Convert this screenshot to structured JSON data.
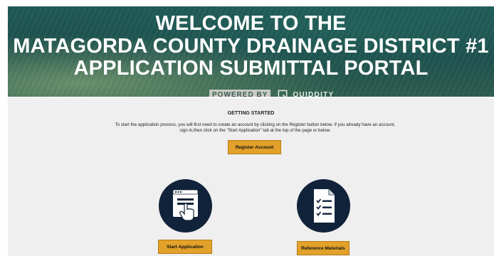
{
  "header": {
    "title_line1": "WELCOME TO THE",
    "title_line2": "MATAGORDA COUNTY DRAINAGE DISTRICT #1",
    "title_line3": "APPLICATION SUBMITTAL PORTAL",
    "powered_by": "POWERED BY",
    "brand": "QUIDDITY"
  },
  "main": {
    "heading": "GETTING STARTED",
    "intro": "To start the application process, you will first need to create an account by clicking on the Register button below. If you already have an account, sign in,then click on the \"Start Application\" tab at the top of the page or below.",
    "register_label": "Register Account",
    "start_label": "Start Application",
    "reference_label": "Reference Materials",
    "start_icon": "browser-hand-pointer-icon",
    "reference_icon": "document-checklist-icon"
  },
  "colors": {
    "banner": "#1f5a56",
    "button": "#e2a12a",
    "icon_circle": "#11233a"
  }
}
